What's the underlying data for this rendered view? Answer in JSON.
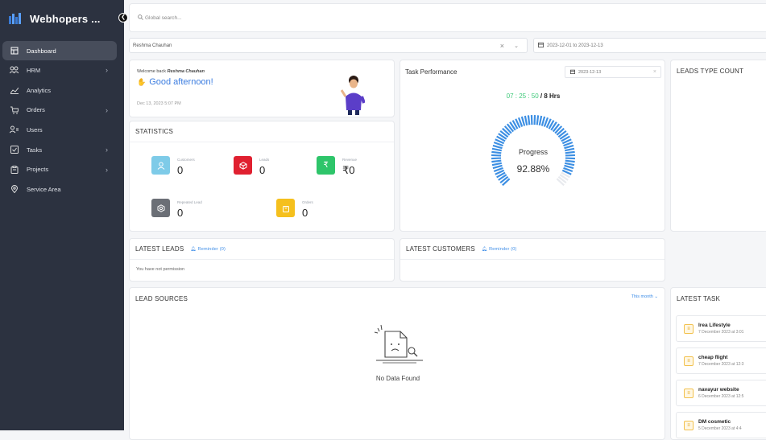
{
  "brand": {
    "name": "Webhopers ..."
  },
  "sidebar": {
    "items": [
      {
        "label": "Dashboard"
      },
      {
        "label": "HRM"
      },
      {
        "label": "Analytics"
      },
      {
        "label": "Orders"
      },
      {
        "label": "Users"
      },
      {
        "label": "Tasks"
      },
      {
        "label": "Projects"
      },
      {
        "label": "Service Area"
      }
    ]
  },
  "search": {
    "placeholder": "Global search..."
  },
  "filters": {
    "user": "Reshma Chauhan",
    "date_range": "2023-12-01 to 2023-12-13"
  },
  "welcome": {
    "prefix": "Welcome back",
    "name": "Reshma Chauhan",
    "greeting": "Good afternoon!",
    "timestamp": "Dec 13, 2023 5:07 PM"
  },
  "statistics": {
    "title": "STATISTICS",
    "items": [
      {
        "label": "Customers",
        "value": "0",
        "color": "#7ecbe8"
      },
      {
        "label": "Leads",
        "value": "0",
        "color": "#e02030"
      },
      {
        "label": "Revenue",
        "value": "₹0",
        "color": "#2ec56a"
      },
      {
        "label": "Repeated Lead",
        "value": "0",
        "color": "#6b6f76"
      },
      {
        "label": "Orders",
        "value": "0",
        "color": "#f5c01d"
      }
    ]
  },
  "task_performance": {
    "title": "Task Performance",
    "date": "2023-12-13",
    "elapsed": "07 : 25 : 50",
    "total": "/ 8 Hrs",
    "gauge_label": "Progress",
    "gauge_value": "92.88%",
    "progress_fraction": 0.9288
  },
  "leads_type_count": {
    "title": "LEADS TYPE COUNT"
  },
  "latest_leads": {
    "title": "LATEST LEADS",
    "reminder": "Reminder (0)",
    "message": "You have not permission"
  },
  "latest_customers": {
    "title": "LATEST CUSTOMERS",
    "reminder": "Reminder (0)"
  },
  "lead_sources": {
    "title": "LEAD SOURCES",
    "period": "This month",
    "empty": "No Data Found"
  },
  "latest_task": {
    "title": "LATEST TASK",
    "items": [
      {
        "title": "Irea Lifestyle",
        "date": "7 December 2023 at 3:01"
      },
      {
        "title": "cheap flight",
        "date": "7 December 2023 at 12:3"
      },
      {
        "title": "navayur website",
        "date": "6 December 2023 at 12:5"
      },
      {
        "title": "DM cosmetic",
        "date": "5 December 2023 at 4:4"
      }
    ]
  }
}
